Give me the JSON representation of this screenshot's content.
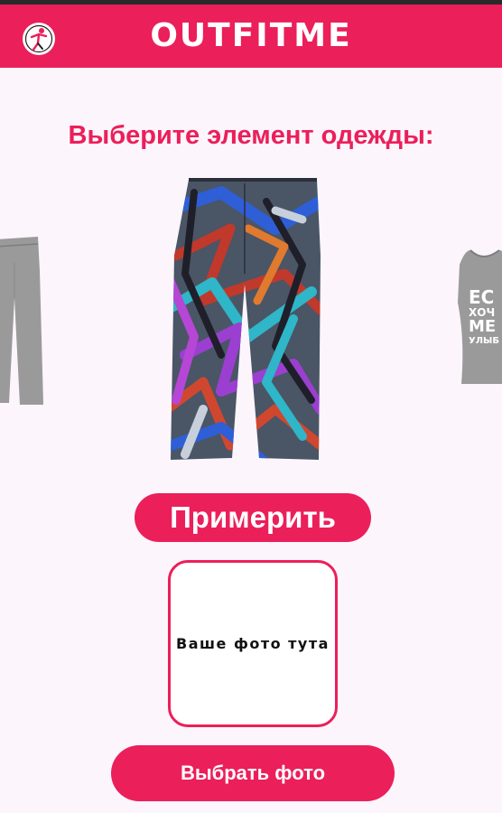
{
  "header": {
    "app_title": "OUTFITME",
    "logo_icon": "brand-figure-icon",
    "accent_color": "#eb1f5a"
  },
  "main": {
    "prompt": "Выберите элемент одежды:",
    "carousel": {
      "items": [
        {
          "name": "previous-item",
          "icon": "gray-pants-icon"
        },
        {
          "name": "current-item",
          "icon": "graffiti-pants-icon"
        },
        {
          "name": "next-item",
          "icon": "gray-tank-top-icon",
          "print_lines": [
            "ЕС",
            "ХОЧ",
            "МЕ",
            "УЛЫБ"
          ]
        }
      ]
    },
    "try_on_label": "Примерить",
    "photo_placeholder": "Ваше фото тута",
    "choose_photo_label": "Выбрать фото"
  }
}
